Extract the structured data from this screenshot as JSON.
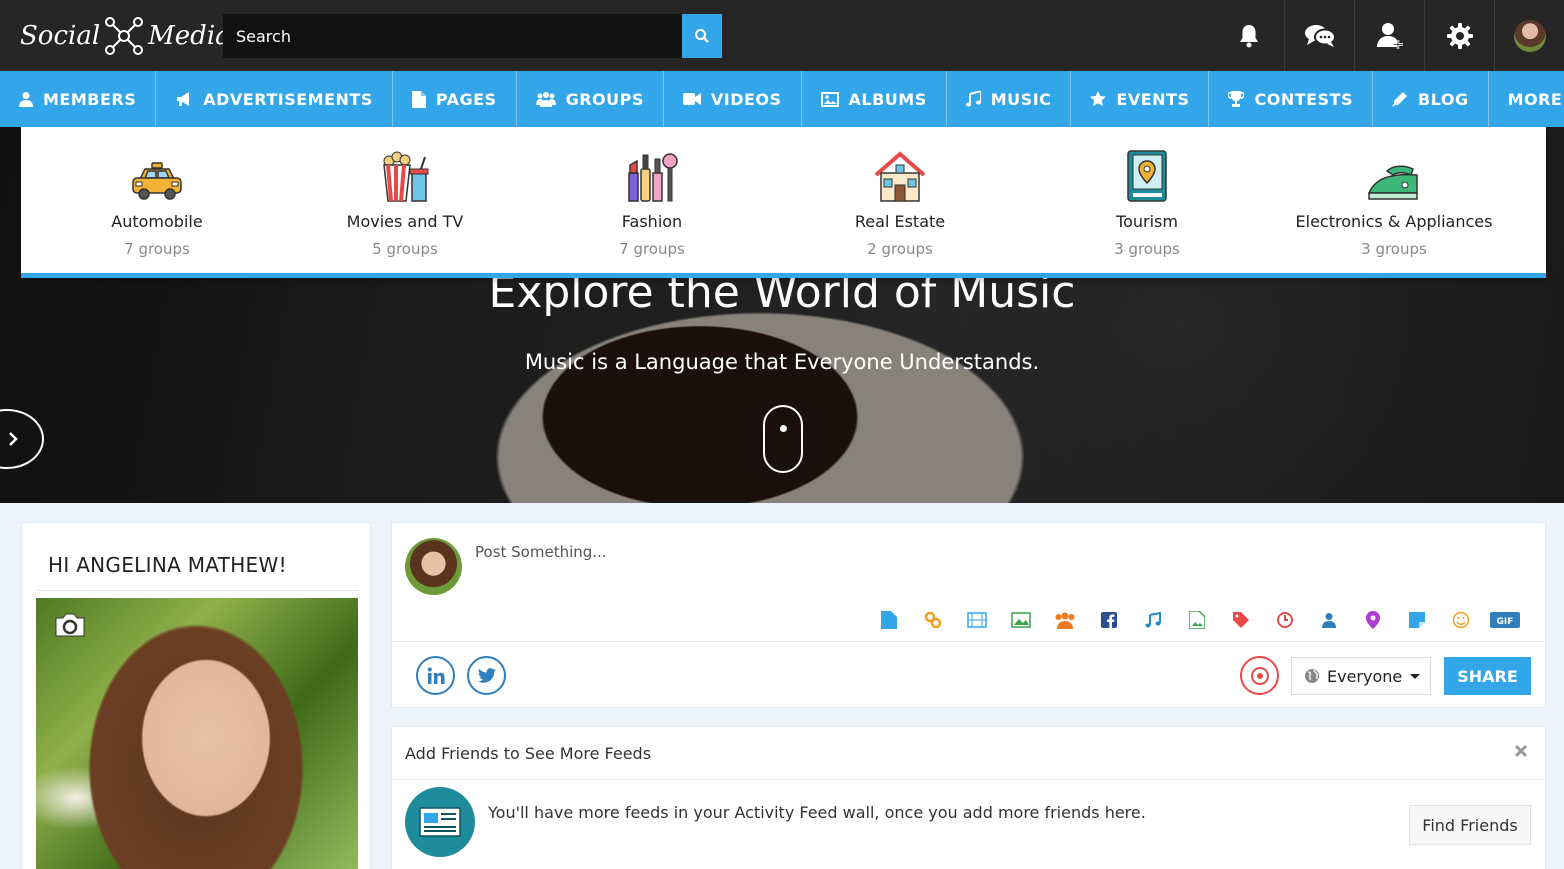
{
  "header": {
    "logo_left": "Social",
    "logo_right": "Media",
    "search": {
      "placeholder": "Search"
    },
    "icons": [
      "bell-icon",
      "chat-icon",
      "add-user-icon",
      "gear-icon",
      "avatar"
    ]
  },
  "nav": {
    "items": [
      {
        "label": "MEMBERS",
        "icon": "user-icon"
      },
      {
        "label": "ADVERTISEMENTS",
        "icon": "bullhorn-icon"
      },
      {
        "label": "PAGES",
        "icon": "file-icon"
      },
      {
        "label": "GROUPS",
        "icon": "users-icon"
      },
      {
        "label": "VIDEOS",
        "icon": "video-camera-icon"
      },
      {
        "label": "ALBUMS",
        "icon": "picture-icon"
      },
      {
        "label": "MUSIC",
        "icon": "music-note-icon"
      },
      {
        "label": "EVENTS",
        "icon": "star-icon"
      },
      {
        "label": "CONTESTS",
        "icon": "trophy-icon"
      },
      {
        "label": "BLOG",
        "icon": "pencil-icon"
      },
      {
        "label": "MORE +",
        "icon": ""
      }
    ]
  },
  "dropdown": {
    "categories": [
      {
        "name": "Automobile",
        "count": "7 groups",
        "icon": "taxi-icon"
      },
      {
        "name": "Movies and TV",
        "count": "5 groups",
        "icon": "popcorn-icon"
      },
      {
        "name": "Fashion",
        "count": "7 groups",
        "icon": "cosmetics-icon"
      },
      {
        "name": "Real Estate",
        "count": "2 groups",
        "icon": "house-icon"
      },
      {
        "name": "Tourism",
        "count": "3 groups",
        "icon": "map-book-icon"
      },
      {
        "name": "Electronics & Appliances",
        "count": "3 groups",
        "icon": "iron-icon"
      }
    ]
  },
  "hero": {
    "title": "Explore the World of Music",
    "subtitle": "Music is a Language that Everyone Understands."
  },
  "profile": {
    "greeting": "HI ANGELINA MATHEW!"
  },
  "composer": {
    "placeholder": "Post Something...",
    "privacy": "Everyone",
    "share_label": "SHARE",
    "tools": [
      "file-icon",
      "link-icon",
      "film-icon",
      "image-icon",
      "group-icon",
      "facebook-icon",
      "music-icon",
      "photo-icon",
      "tag-icon",
      "clock-icon",
      "user-icon",
      "location-icon",
      "sticker-icon",
      "emoji-icon",
      "gif-icon"
    ]
  },
  "friends_card": {
    "title": "Add Friends to See More Feeds",
    "message": "You'll have more feeds in your Activity Feed wall, once you add more friends here.",
    "button": "Find Friends"
  },
  "colors": {
    "accent": "#33a6ea",
    "topbar": "#262626",
    "background": "#eef2fb"
  }
}
